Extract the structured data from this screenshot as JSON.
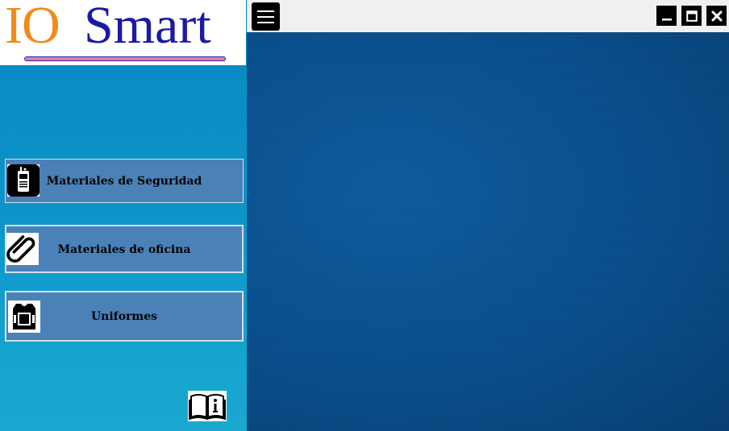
{
  "logo": {
    "part1": "IO",
    "part2": "Smart"
  },
  "sidebar": {
    "items": [
      {
        "label": "Materiales de Seguridad",
        "icon": "walkie-talkie-icon"
      },
      {
        "label": "Materiales de oficina",
        "icon": "paperclip-icon"
      },
      {
        "label": "Uniformes",
        "icon": "vest-icon"
      }
    ],
    "info_icon": "book-info-icon"
  },
  "topbar": {
    "menu_icon": "hamburger-icon",
    "window_controls": [
      "minimize-icon",
      "maximize-icon",
      "close-icon"
    ]
  },
  "colors": {
    "sidebar": "#0b8fc6",
    "button": "#4a82b8",
    "main_bg": "#0a4f8c",
    "logo_io": "#f28a1a",
    "logo_smart": "#1a1aa6"
  }
}
